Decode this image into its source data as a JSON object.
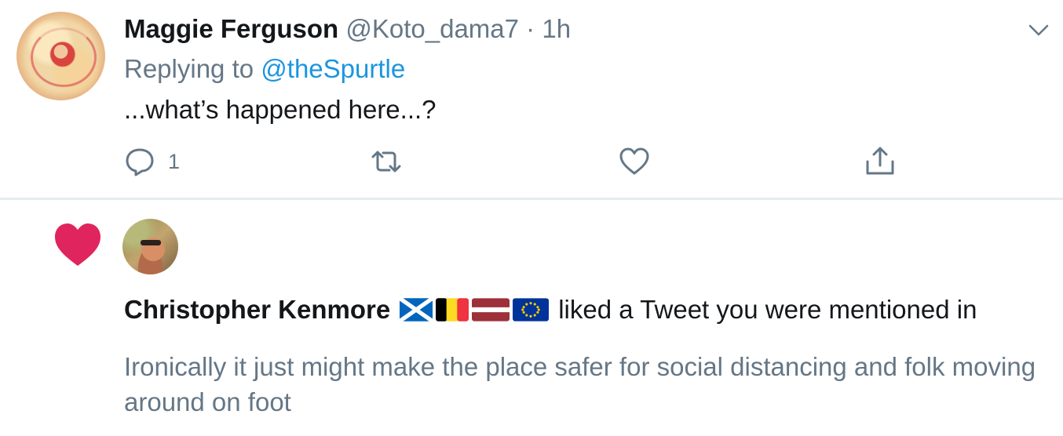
{
  "tweet": {
    "author_name": "Maggie Ferguson",
    "handle": "@Koto_dama7",
    "separator": "·",
    "time": "1h",
    "replying_prefix": "Replying to",
    "replying_handle": "@theSpurtle",
    "text": "...what’s happened here...?",
    "actions": {
      "reply_icon": "reply-icon",
      "reply_count": "1",
      "retweet_icon": "retweet-icon",
      "like_icon": "heart-outline-icon",
      "share_icon": "share-icon"
    },
    "menu_icon": "chevron-down-icon"
  },
  "notification": {
    "icon": "heart-filled-icon",
    "user_name": "Christopher Kenmore",
    "flags": [
      "scotland-flag",
      "belgium-flag",
      "latvia-flag",
      "eu-flag"
    ],
    "action_text": "liked a Tweet you were mentioned in",
    "tweet_text": "Ironically it just might make the place safer for social distancing and folk moving around on foot"
  },
  "colors": {
    "text_primary": "#14171a",
    "text_secondary": "#657786",
    "link": "#1b95e0",
    "like": "#e0245e",
    "divider": "#e6ecf0"
  }
}
